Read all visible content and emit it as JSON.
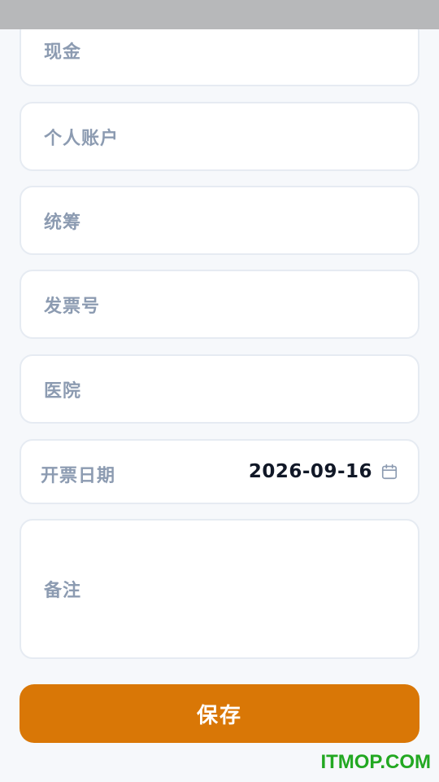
{
  "form": {
    "cash_placeholder": "现金",
    "personal_account_placeholder": "个人账户",
    "pooled_fund_placeholder": "统筹",
    "invoice_number_placeholder": "发票号",
    "hospital_placeholder": "医院",
    "invoice_date_label": "开票日期",
    "invoice_date_value": "2026-09-16",
    "remark_placeholder": "备注"
  },
  "actions": {
    "save_label": "保存"
  },
  "watermark": "ITMOP.COM",
  "colors": {
    "accent": "#d97706",
    "placeholder_text": "#8c9bb1",
    "watermark": "#22a822"
  },
  "icons": {
    "date_picker": "calendar-icon"
  }
}
